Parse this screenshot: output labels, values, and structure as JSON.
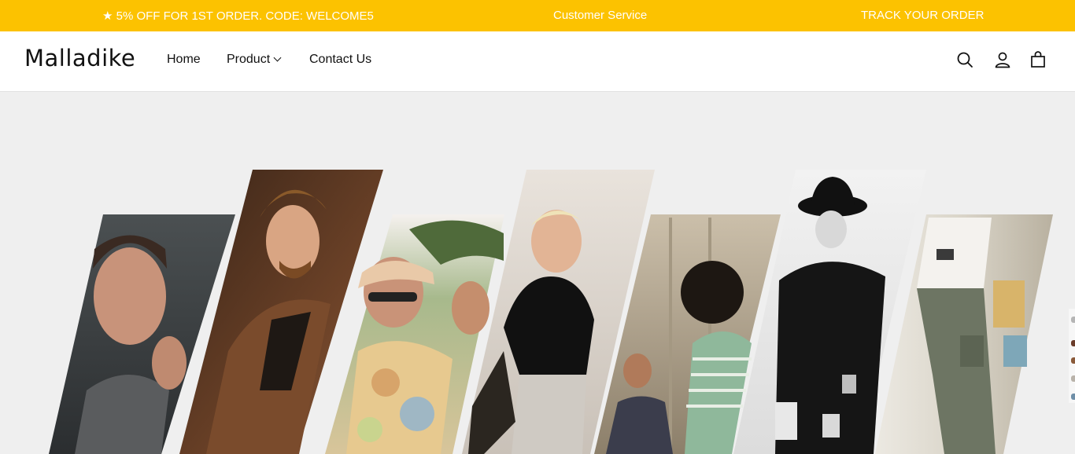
{
  "announcement": {
    "promo": "★ 5% OFF FOR 1ST ORDER. CODE: WELCOME5",
    "service": "Customer Service",
    "track": "TRACK YOUR ORDER",
    "bg_color": "#fcc200"
  },
  "header": {
    "logo": "Malladike",
    "nav": {
      "home": "Home",
      "product": "Product",
      "contact": "Contact Us"
    },
    "icons": [
      "search-icon",
      "account-icon",
      "cart-icon"
    ]
  },
  "hero": {
    "panels": [
      "portrait-man-hand-on-chin",
      "man-brown-suit",
      "man-cap-floral-shirt",
      "man-black-tee",
      "seated-group",
      "figure-black-coat-hat",
      "cargo-pants-outfit"
    ]
  }
}
